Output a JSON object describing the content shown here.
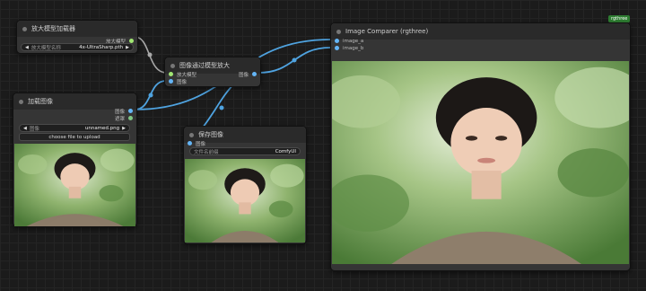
{
  "badge": "rgthree",
  "nodes": {
    "upscale_loader": {
      "title": "放大模型加载器",
      "output_label": "放大模型",
      "widget_label": "放大模型名称",
      "widget_value": "4x-UltraSharp.pth"
    },
    "upscale_with_model": {
      "title": "图像通过模型放大",
      "input_1": "放大模型",
      "input_2": "图像",
      "output_label": "图像"
    },
    "load_image": {
      "title": "加载图像",
      "output_1": "图像",
      "output_2": "遮罩",
      "widget_label": "图像",
      "widget_value": "unnamed.png",
      "upload_button": "choose file to upload"
    },
    "save_image": {
      "title": "保存图像",
      "input_label": "图像",
      "widget_label": "文件名前缀",
      "widget_value": "ComfyUI"
    },
    "comparer": {
      "title": "Image Comparer (rgthree)",
      "input_a": "image_a",
      "input_b": "image_b"
    }
  },
  "colors": {
    "link_image": "#4fa3e0",
    "link_upscale": "#a0a0a0",
    "badge": "#2e7d32"
  }
}
